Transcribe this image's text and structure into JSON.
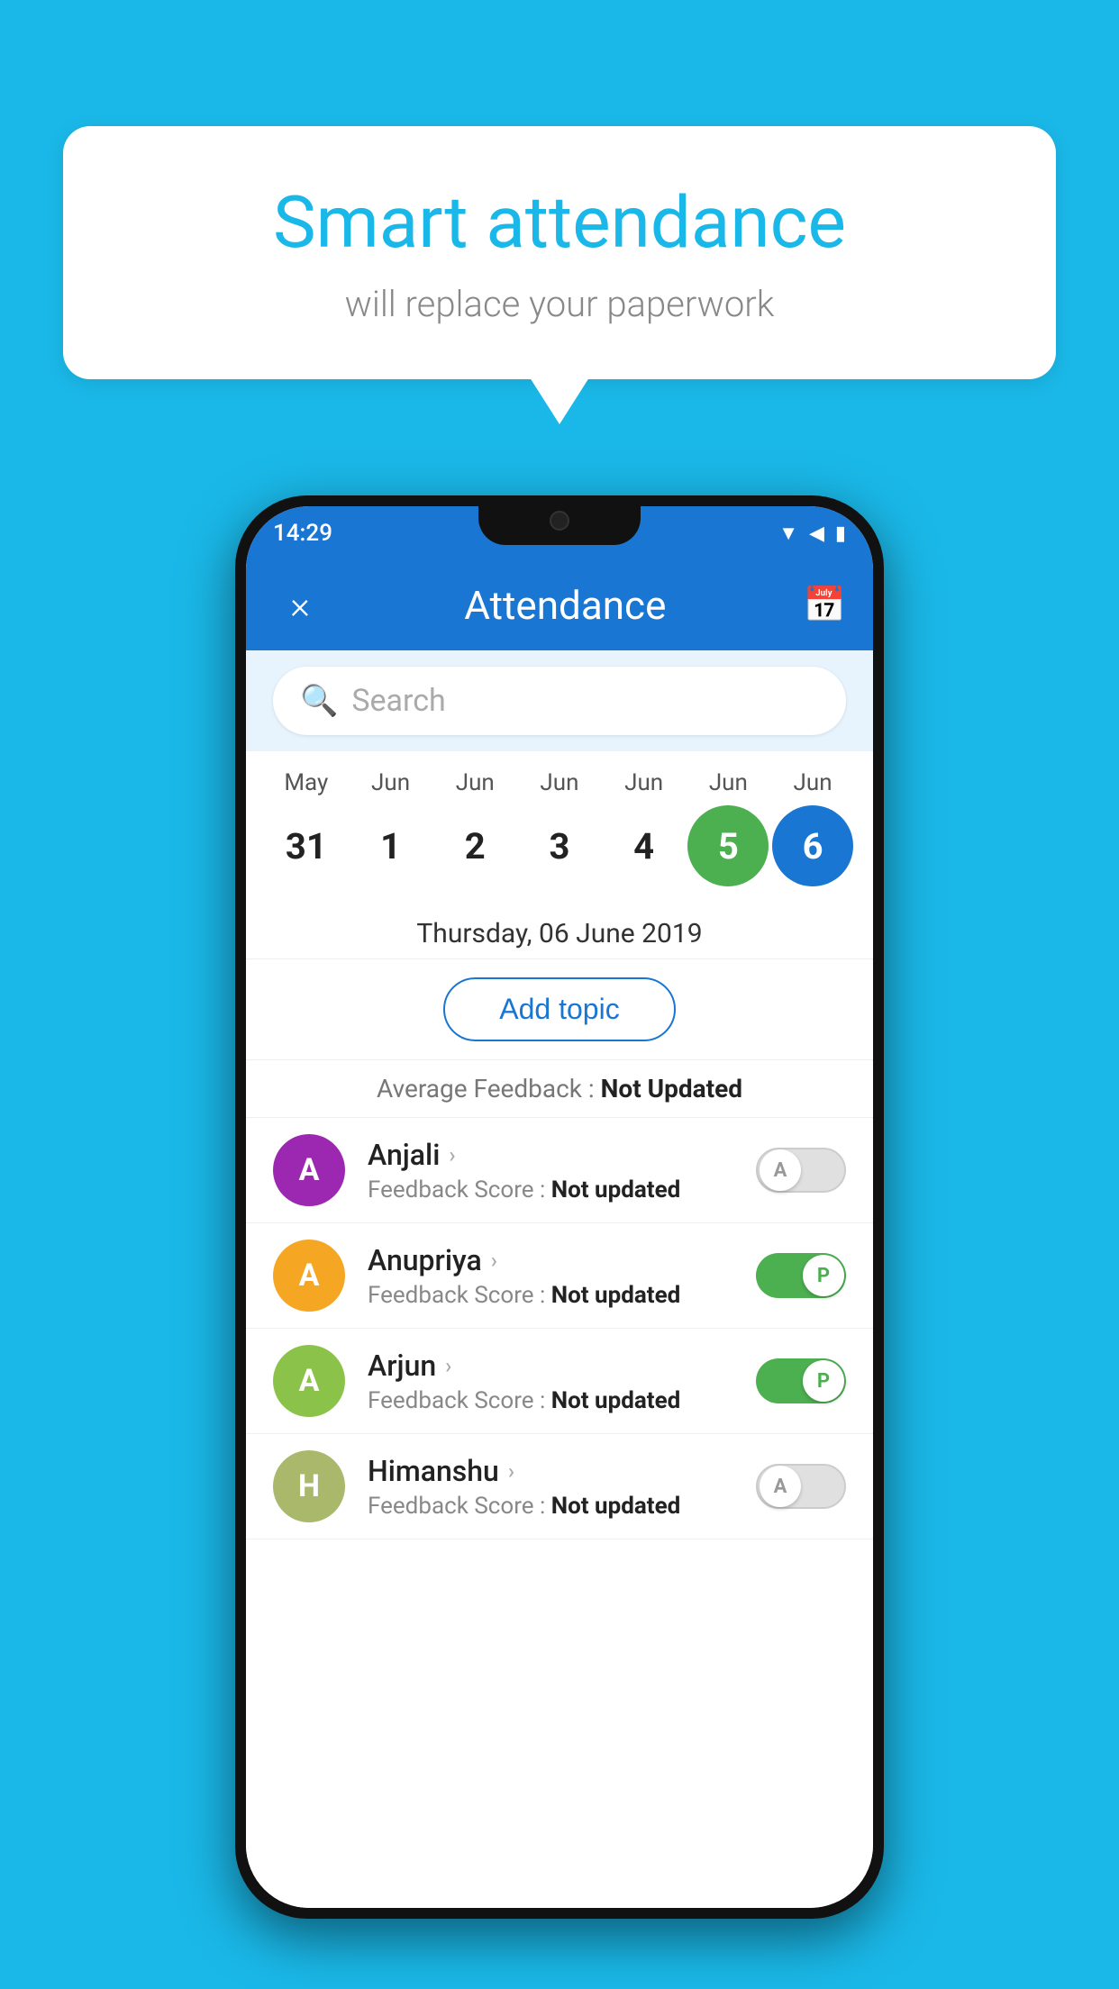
{
  "background_color": "#1ab8e8",
  "bubble": {
    "title": "Smart attendance",
    "subtitle": "will replace your paperwork"
  },
  "phone": {
    "status_bar": {
      "time": "14:29"
    },
    "app_bar": {
      "title": "Attendance",
      "close_label": "×",
      "calendar_icon": "📅"
    },
    "search": {
      "placeholder": "Search"
    },
    "dates": {
      "selected_label": "Thursday, 06 June 2019",
      "add_topic_label": "Add topic",
      "avg_feedback_label": "Average Feedback :",
      "avg_feedback_value": "Not Updated",
      "months": [
        "May",
        "Jun",
        "Jun",
        "Jun",
        "Jun",
        "Jun",
        "Jun"
      ],
      "days": [
        "31",
        "1",
        "2",
        "3",
        "4",
        "5",
        "6"
      ],
      "day_states": [
        "normal",
        "normal",
        "normal",
        "normal",
        "normal",
        "today",
        "selected"
      ]
    },
    "students": [
      {
        "name": "Anjali",
        "initial": "A",
        "avatar_color": "#9c27b0",
        "score_label": "Feedback Score :",
        "score_value": "Not updated",
        "toggle_state": "off",
        "toggle_label": "A"
      },
      {
        "name": "Anupriya",
        "initial": "A",
        "avatar_color": "#f5a623",
        "score_label": "Feedback Score :",
        "score_value": "Not updated",
        "toggle_state": "on",
        "toggle_label": "P"
      },
      {
        "name": "Arjun",
        "initial": "A",
        "avatar_color": "#8bc34a",
        "score_label": "Feedback Score :",
        "score_value": "Not updated",
        "toggle_state": "on",
        "toggle_label": "P"
      },
      {
        "name": "Himanshu",
        "initial": "H",
        "avatar_color": "#aab86c",
        "score_label": "Feedback Score :",
        "score_value": "Not updated",
        "toggle_state": "off",
        "toggle_label": "A"
      }
    ]
  }
}
